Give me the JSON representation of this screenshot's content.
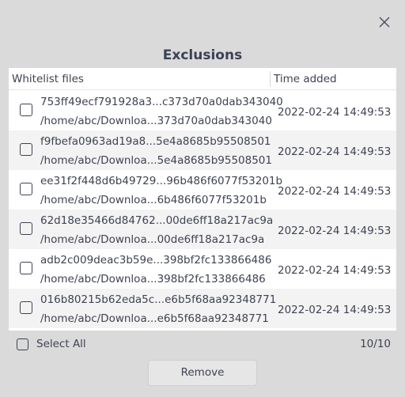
{
  "dialog": {
    "title": "Exclusions",
    "close_icon": "close-icon"
  },
  "table": {
    "columns": [
      "Whitelist files",
      "Time added"
    ],
    "rows": [
      {
        "hash": "753ff49ecf791928a3...c373d70a0dab343040",
        "path": "/home/abc/Downloa...373d70a0dab343040",
        "time": "2022-02-24 14:49:53",
        "checked": false
      },
      {
        "hash": "f9fbefa0963ad19a8...5e4a8685b95508501",
        "path": "/home/abc/Downloa...5e4a8685b95508501",
        "time": "2022-02-24 14:49:53",
        "checked": false
      },
      {
        "hash": "ee31f2f448d6b49729...96b486f6077f53201b",
        "path": "/home/abc/Downloa...6b486f6077f53201b",
        "time": "2022-02-24 14:49:53",
        "checked": false
      },
      {
        "hash": "62d18e35466d84762...00de6ff18a217ac9a",
        "path": "/home/abc/Downloa...00de6ff18a217ac9a",
        "time": "2022-02-24 14:49:53",
        "checked": false
      },
      {
        "hash": "adb2c009deac3b59e...398bf2fc133866486",
        "path": "/home/abc/Downloa...398bf2fc133866486",
        "time": "2022-02-24 14:49:53",
        "checked": false
      },
      {
        "hash": "016b80215b62eda5c...e6b5f68aa92348771",
        "path": "/home/abc/Downloa...e6b5f68aa92348771",
        "time": "2022-02-24 14:49:53",
        "checked": false
      }
    ]
  },
  "footer": {
    "select_all_label": "Select All",
    "count_label": "10/10",
    "remove_label": "Remove"
  }
}
